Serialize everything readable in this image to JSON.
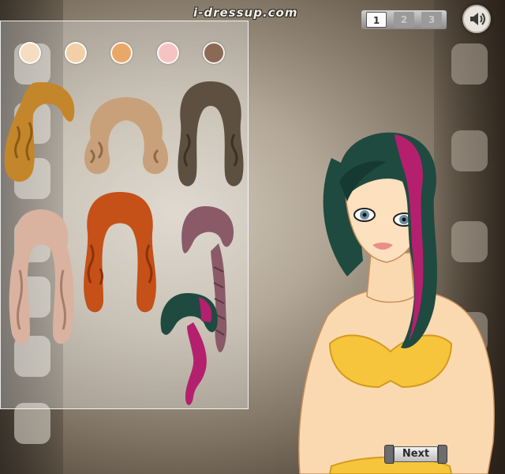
{
  "header": {
    "logo_text": "i-dressup.com"
  },
  "pages": {
    "tabs": [
      "1",
      "2",
      "3"
    ],
    "active": "1"
  },
  "sound_button": {
    "icon": "speaker-icon"
  },
  "skin_swatches": [
    {
      "name": "skin-tone-1",
      "color": "#f6dcc0"
    },
    {
      "name": "skin-tone-2",
      "color": "#f2cfa6"
    },
    {
      "name": "skin-tone-3",
      "color": "#e9a868"
    },
    {
      "name": "skin-tone-4",
      "color": "#f7c3c2"
    },
    {
      "name": "skin-tone-5",
      "color": "#8a6a55"
    }
  ],
  "hairstyles": [
    {
      "name": "hair-golden-curly-side",
      "color": "#c4862a",
      "accent": "#8a5a18"
    },
    {
      "name": "hair-blonde-bob-curls",
      "color": "#c8a17a",
      "accent": "#8f6a48"
    },
    {
      "name": "hair-brown-wavy",
      "color": "#5d5040",
      "accent": "#3a3128"
    },
    {
      "name": "hair-pink-blonde-pigtails",
      "color": "#d9b2a0",
      "accent": "#a67e6c"
    },
    {
      "name": "hair-red-long-curly",
      "color": "#c55018",
      "accent": "#8a320c"
    },
    {
      "name": "hair-mauve-braid",
      "color": "#8a5a68",
      "accent": "#5a3844"
    },
    {
      "name": "hair-green-magenta-side",
      "color": "#1f4a40",
      "accent": "#b4206e"
    }
  ],
  "next_button": {
    "label": "Next"
  }
}
